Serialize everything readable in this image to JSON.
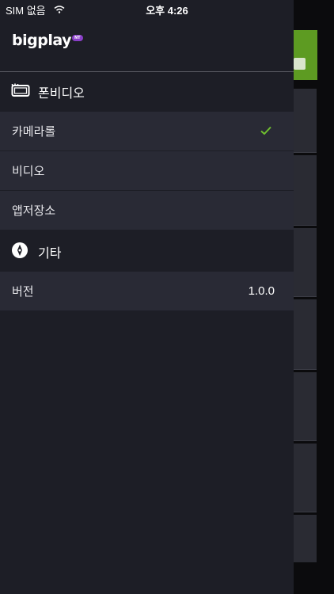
{
  "status_bar": {
    "carrier": "SIM 없음",
    "time": "오후 4:26"
  },
  "brand": {
    "logo": "bigplay",
    "badge": "NT"
  },
  "sections": [
    {
      "title": "폰비디오",
      "icon": "tv-icon",
      "items": [
        {
          "label": "카메라롤",
          "selected": true
        },
        {
          "label": "비디오",
          "selected": false
        },
        {
          "label": "앱저장소",
          "selected": false
        }
      ]
    },
    {
      "title": "기타",
      "icon": "compass-icon",
      "items": [
        {
          "label": "버전",
          "value": "1.0.0"
        }
      ]
    }
  ],
  "colors": {
    "drawer_bg": "#1d1e26",
    "item_bg": "#292a35",
    "check": "#6fbf2f",
    "logo_badge": "#8a3fc8",
    "background_accent": "#5d9b22"
  }
}
